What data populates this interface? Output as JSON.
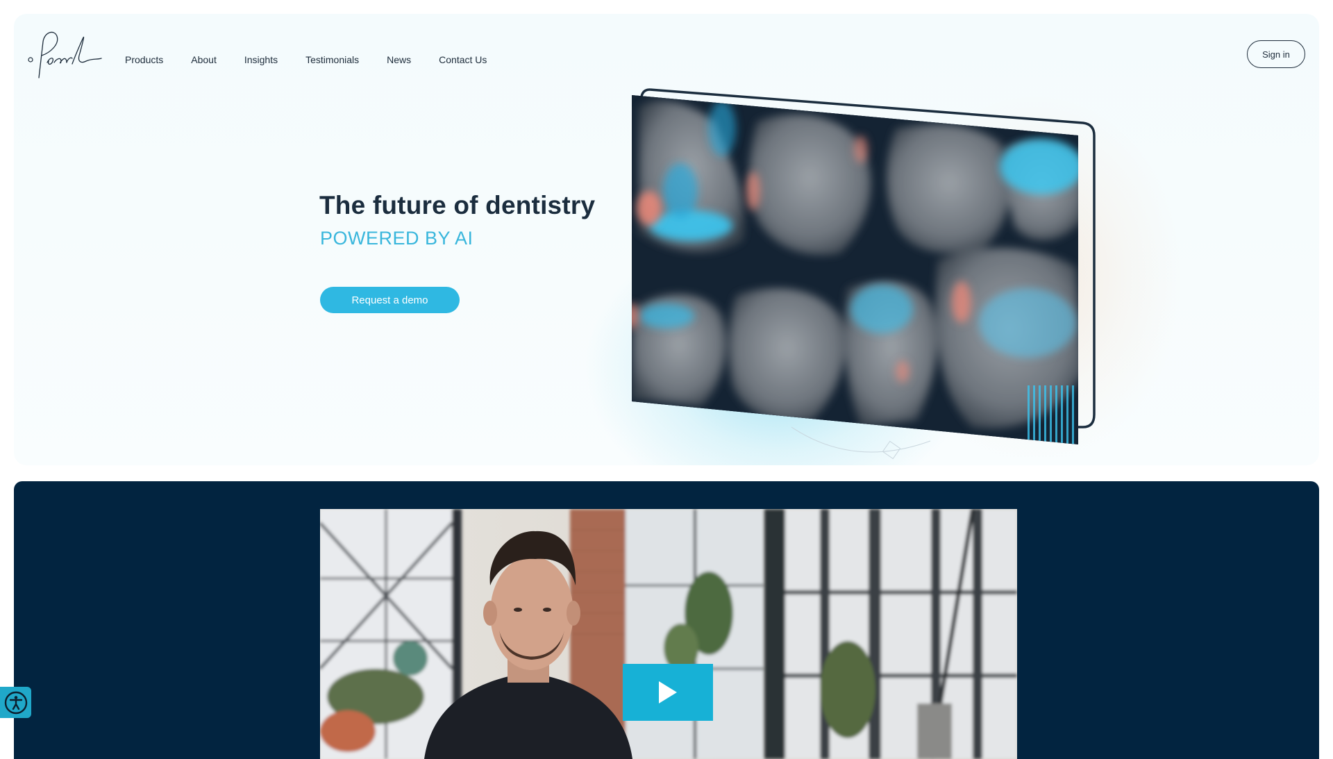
{
  "brand": {
    "name": "Pearl"
  },
  "nav": {
    "items": [
      {
        "label": "Products"
      },
      {
        "label": "About"
      },
      {
        "label": "Insights"
      },
      {
        "label": "Testimonials"
      },
      {
        "label": "News"
      },
      {
        "label": "Contact Us"
      }
    ],
    "signin_label": "Sign in"
  },
  "hero": {
    "headline": "The future of dentistry",
    "subhead": "POWERED BY AI",
    "cta_label": "Request a demo"
  },
  "colors": {
    "accent": "#2fb8e2",
    "navy": "#022440",
    "text": "#1b2d3e"
  },
  "icons": {
    "play": "play-icon",
    "accessibility": "accessibility-icon"
  }
}
